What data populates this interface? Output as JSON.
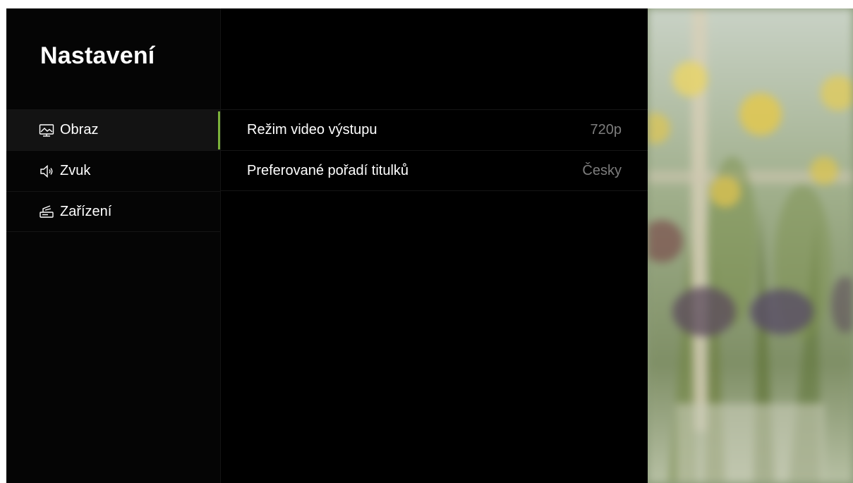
{
  "header": {
    "title": "Nastavení"
  },
  "sidebar": {
    "items": [
      {
        "label": "Obraz",
        "icon": "picture-icon",
        "active": true
      },
      {
        "label": "Zvuk",
        "icon": "speaker-icon",
        "active": false
      },
      {
        "label": "Zařízení",
        "icon": "device-icon",
        "active": false
      }
    ]
  },
  "settings": [
    {
      "label": "Režim video výstupu",
      "value": "720p"
    },
    {
      "label": "Preferované pořadí titulků",
      "value": "Česky"
    }
  ],
  "colors": {
    "accent": "#7bb23b",
    "background": "#000000",
    "text": "#ffffff",
    "value_text": "#7d7d7d"
  },
  "preview": {
    "description_icon": "background-photo"
  }
}
